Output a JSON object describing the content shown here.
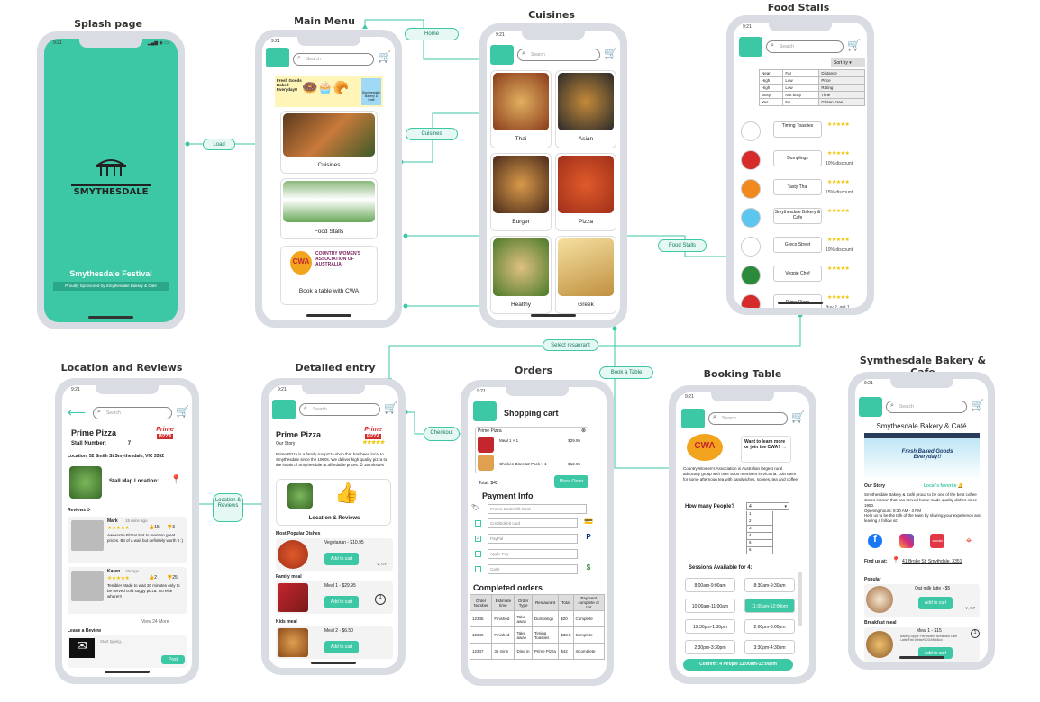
{
  "titles": {
    "splash": "Splash page",
    "main_menu": "Main Menu",
    "cuisines": "Cuisines",
    "food_stalls": "Food Stalls",
    "location": "Location and Reviews",
    "detailed": "Detailed entry",
    "orders": "Orders",
    "booking": "Booking Table",
    "bakery": "Symthesdale Bakery & Cafe"
  },
  "status_time": "9:21",
  "search_placeholder": "Search",
  "flow_labels": {
    "load": "Load",
    "home": "Home",
    "cuisines": "Cuisines",
    "food_stalls": "Food Stalls",
    "select_restaurant": "Select resaurant",
    "book_table": "Book a Table",
    "checkout": "Checkout",
    "location_reviews": "Location & Reviews"
  },
  "splash": {
    "logo_text": "SMYTHESDALE",
    "festival": "Smythesdale Festival",
    "sponsor": "Proudly Sponsored by Smythesdale Bakery & Cafe"
  },
  "main_menu": {
    "banner_left": "Fresh Goods Baked Everyday!!",
    "banner_right": "Smythesdale Bakery & Cafe",
    "items": [
      "Cuisines",
      "Food Stalls",
      "Book a table with CWA"
    ],
    "cwa_text": "COUNTRY WOMEN'S ASSOCIATION OF AUSTRALIA"
  },
  "cuisines": {
    "items": [
      "Thai",
      "Asian",
      "Burger",
      "Pizza",
      "Healthy",
      "Greek"
    ]
  },
  "food_stalls": {
    "sort_label": "Sort by",
    "filter_rows": [
      [
        "Near",
        "Far",
        "Distance"
      ],
      [
        "High",
        "Low",
        "Price"
      ],
      [
        "High",
        "Low",
        "Rating"
      ],
      [
        "Busy",
        "Not busy",
        "Time"
      ],
      [
        "Yes",
        "No",
        "Gluten Free"
      ]
    ],
    "stalls": [
      {
        "name": "Timing Toasties",
        "note": ""
      },
      {
        "name": "Dumplings",
        "note": "10% discount"
      },
      {
        "name": "Tasty Thai",
        "note": "15% discount"
      },
      {
        "name": "Smythesdale Bakery & Cafe",
        "note": ""
      },
      {
        "name": "Greco Street",
        "note": "10% discount"
      },
      {
        "name": "Veggie Chef",
        "note": ""
      },
      {
        "name": "Prime Pizza",
        "note": "Buy 2, get 1"
      }
    ]
  },
  "location": {
    "name": "Prime Pizza",
    "stall_number_label": "Stall Number:",
    "stall_number": "7",
    "address": "Location: 52 Smith St Smythesdale, VIC 3352",
    "stall_map": "Stall Map Location:",
    "reviews_label": "Reviews",
    "reviews": [
      {
        "author": "Mark",
        "time": "15 mins ago",
        "likes": "15",
        "dislikes": "3",
        "text": "Awesome Pizza! Not to mention great prices. Bit of a wait but definitely worth it :)"
      },
      {
        "author": "Karen",
        "time": "1hr ago",
        "likes": "2",
        "dislikes": "25",
        "text": "Terrible! Made to wait 30 minutes only to be served cold soggy pizza. Go else where!!!"
      }
    ],
    "view_more": "View 24 More",
    "leave_review": "Leave a Review",
    "review_placeholder": "Start typing...",
    "post": "Post"
  },
  "detailed": {
    "name": "Prime Pizza",
    "our_story": "Our Story",
    "story": "Prime Pizza is a family run pizza shop that has been local to Smythesdale since the 1960s. We deliver high quality pizza to the locals of Smythesdale at affordable prices.",
    "wait": "35 minutes",
    "loc_reviews": "Location & Reviews",
    "popular": "Most Popular Dishes",
    "family": "Family meal",
    "kids": "Kids meal",
    "dishes": [
      {
        "name": "Vegetarian - $10.95",
        "tags": "V, GF"
      },
      {
        "name": "Meal 1 - $29.95",
        "tags": ""
      },
      {
        "name": "Meal 2 - $6.50",
        "tags": ""
      }
    ],
    "add_to_cart": "Add to cart"
  },
  "orders": {
    "cart_title": "Shopping cart",
    "stall": "Prime Pizza",
    "line1": "Meal 1 × 1",
    "line1_price": "$29.95",
    "line2": "Chicken Bites 12 Pack × 1",
    "line2_price": "$12.05",
    "total": "Total: $42",
    "place_order": "Place Order",
    "payment_info": "Payment Info",
    "promo": "Promo Code/Gift Card",
    "methods": [
      "Credit/debit card",
      "PayPal",
      "Apple Pay",
      "Cash"
    ],
    "completed": "Completed orders",
    "headers": [
      "Order Number",
      "Estimate time",
      "Order Type",
      "Restaurant",
      "Total",
      "Payment complete or not"
    ],
    "rows": [
      [
        "12345",
        "Finished",
        "Take away",
        "Dumplings",
        "$20",
        "Complete"
      ],
      [
        "12346",
        "Finished",
        "Take away",
        "Timing Toasties",
        "$33.5",
        "Complete"
      ],
      [
        "12347",
        "35 mins",
        "Dine in",
        "Prime Pizza",
        "$42",
        "Incomplete"
      ]
    ]
  },
  "booking": {
    "cwa_prompt": "Want to learn more or join the CWA?",
    "cwa_desc": "Country Women's Association is Australian largest rural advocacy group with over 5000 members in Victoria. Join them for some afternoon tea with sandwiches, scones, tea and coffee.",
    "people_q": "How many People?",
    "people_options": [
      "1",
      "2",
      "3",
      "4",
      "5",
      "6"
    ],
    "selected": "4",
    "sessions_label": "Sessions Available for 4:",
    "sessions": [
      "8:00am-9:00am",
      "8:30am-9:30am",
      "10:00am-11:00am",
      "11:00am-12:00pm",
      "12:30pm-1:30pm",
      "2:00pm-3:00pm",
      "2:30pm-3:30pm",
      "3:30pm-4:30pm"
    ],
    "confirm": "Confirm: 4 People 11:00am-12:00pm"
  },
  "bakery": {
    "title": "Smythesdale Bakery & Café",
    "banner": "Fresh Baked Goods Everyday!!",
    "our_story": "Our Story",
    "fav": "Local's favorite",
    "story": "Smythesdale Bakery & Café proud to be one of the best coffee stores in town that has served home made quality dishes since 1950.",
    "hours": "Opening hours: 9:30 AM - 3 PM",
    "help": "Help us to be the talk of the town by sharing your experience and leaving a follow at:",
    "find_us": "Find us at:",
    "address": "41 Broke St, Smythdale, 3351",
    "popular": "Popular",
    "item1": "Oat milk latte - $5",
    "item1_tags": "V, GF",
    "breakfast": "Breakfast meal",
    "item2": "Meal 1 - $15",
    "item2_desc": "Bakery Apple Pie/ Muffin/ Breakfast Cafe Latte/Flat White/NOG/MilkBun",
    "add_to_cart": "Add to cart"
  },
  "colors": {
    "accent": "#3cc7a5",
    "frame": "#d9dde3"
  }
}
